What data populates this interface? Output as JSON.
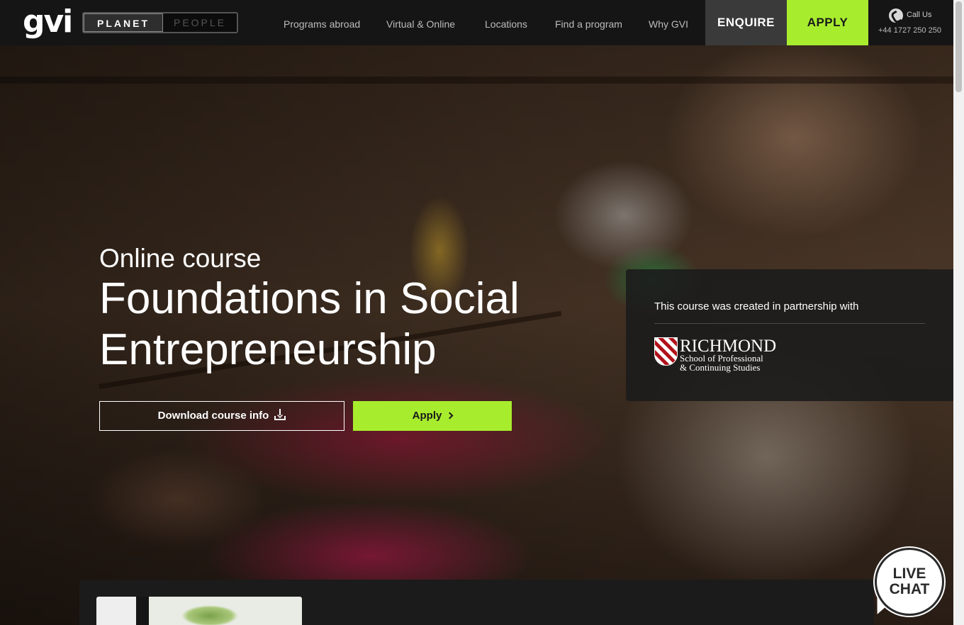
{
  "header": {
    "logo_text": "gvi",
    "toggle": {
      "planet": "PLANET",
      "people": "PEOPLE"
    },
    "nav": [
      {
        "label": "Programs abroad"
      },
      {
        "label": "Virtual & Online"
      },
      {
        "label": "Locations"
      },
      {
        "label": "Find a program"
      },
      {
        "label": "Why GVI"
      }
    ],
    "enquire_label": "ENQUIRE",
    "apply_label": "APPLY",
    "call": {
      "label": "Call Us",
      "number": "+44 1727 250 250",
      "icon": "phone-icon"
    }
  },
  "hero": {
    "subtitle": "Online course",
    "title": "Foundations in Social Entrepreneurship",
    "download_label": "Download course info",
    "apply_label": "Apply"
  },
  "partner": {
    "text": "This course was created in partnership with",
    "logo_name": "RICHMOND",
    "logo_line1": "School of Professional",
    "logo_line2": "& Continuing Studies"
  },
  "live_chat": {
    "line1": "LIVE",
    "line2": "CHAT"
  },
  "colors": {
    "accent": "#a8ec2e",
    "header_bg": "#151515",
    "enquire_bg": "#3a3a3a"
  }
}
